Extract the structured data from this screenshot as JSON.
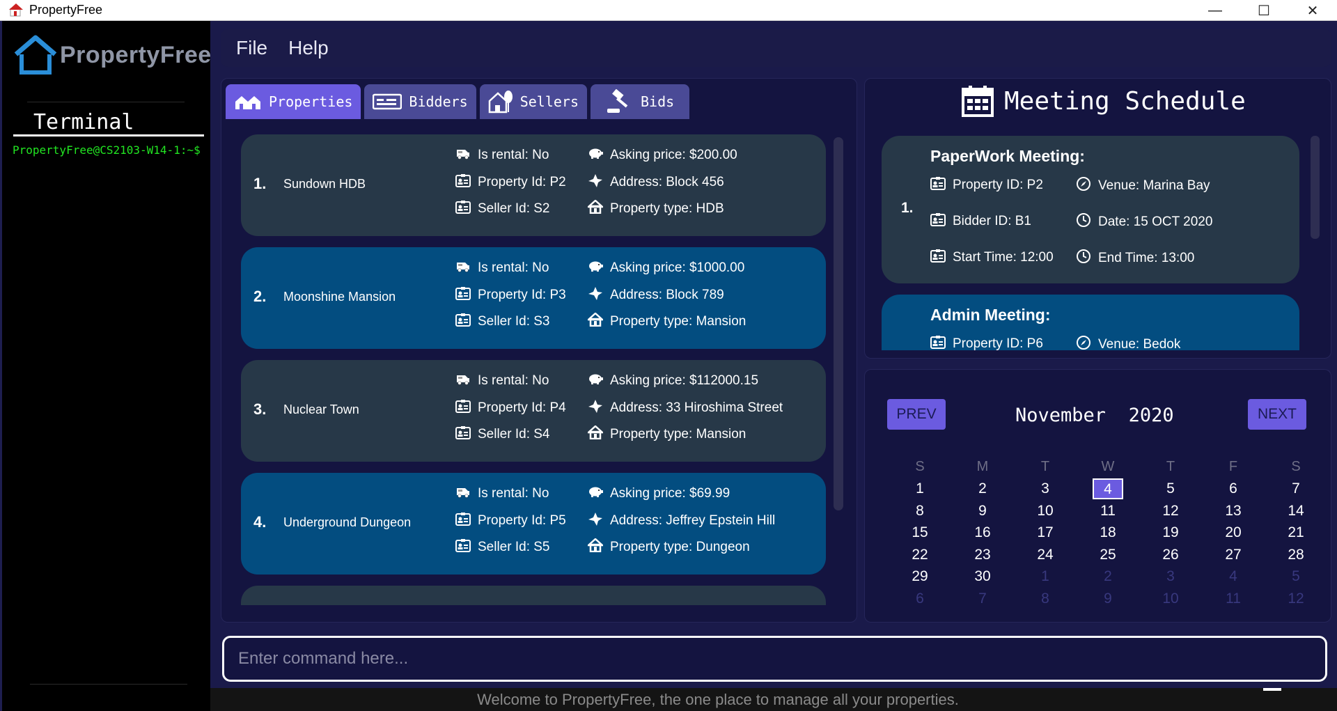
{
  "window": {
    "title": "PropertyFree",
    "controls": {
      "minimize": "—",
      "maximize": "☐",
      "close": "✕"
    }
  },
  "sidebar": {
    "logo_text": "PropertyFree",
    "terminal_title": "Terminal",
    "prompt": "PropertyFree@CS2103-W14-1:~$"
  },
  "menu": {
    "file": "File",
    "help": "Help"
  },
  "tabs": [
    {
      "label": "Properties",
      "icon": "houses-icon",
      "active": true
    },
    {
      "label": "Bidders",
      "icon": "id-card-icon",
      "active": false
    },
    {
      "label": "Sellers",
      "icon": "house-tree-icon",
      "active": false
    },
    {
      "label": "Bids",
      "icon": "gavel-icon",
      "active": false
    }
  ],
  "properties": [
    {
      "index": "1.",
      "name": "Sundown HDB",
      "rental": "Is rental: No",
      "property_id": "Property Id: P2",
      "seller_id": "Seller Id: S2",
      "price": "Asking price: $200.00",
      "address": "Address: Block 456",
      "type": "Property type: HDB"
    },
    {
      "index": "2.",
      "name": "Moonshine Mansion",
      "rental": "Is rental: No",
      "property_id": "Property Id: P3",
      "seller_id": "Seller Id: S3",
      "price": "Asking price: $1000.00",
      "address": "Address: Block 789",
      "type": "Property type: Mansion"
    },
    {
      "index": "3.",
      "name": "Nuclear Town",
      "rental": "Is rental: No",
      "property_id": "Property Id: P4",
      "seller_id": "Seller Id: S4",
      "price": "Asking price: $112000.15",
      "address": "Address: 33 Hiroshima Street",
      "type": "Property type: Mansion"
    },
    {
      "index": "4.",
      "name": "Underground Dungeon",
      "rental": "Is rental: No",
      "property_id": "Property Id: P5",
      "seller_id": "Seller Id: S5",
      "price": "Asking price: $69.99",
      "address": "Address: Jeffrey Epstein Hill",
      "type": "Property type: Dungeon"
    }
  ],
  "meeting_schedule": {
    "title": "Meeting Schedule",
    "meetings": [
      {
        "index": "1.",
        "name": "PaperWork Meeting:",
        "property_id": "Property ID: P2",
        "bidder_id": "Bidder ID: B1",
        "start": "Start Time: 12:00",
        "venue": "Venue: Marina Bay",
        "date": "Date: 15 OCT 2020",
        "end": "End Time: 13:00"
      },
      {
        "index": "",
        "name": "Admin Meeting:",
        "property_id": "Property ID: P6",
        "venue": "Venue: Bedok"
      }
    ]
  },
  "calendar": {
    "prev": "PREV",
    "next": "NEXT",
    "month": "November",
    "year": "2020",
    "weekdays": [
      "S",
      "M",
      "T",
      "W",
      "T",
      "F",
      "S"
    ],
    "selected_day": "4",
    "days": [
      [
        "1",
        "2",
        "3",
        "4",
        "5",
        "6",
        "7"
      ],
      [
        "8",
        "9",
        "10",
        "11",
        "12",
        "13",
        "14"
      ],
      [
        "15",
        "16",
        "17",
        "18",
        "19",
        "20",
        "21"
      ],
      [
        "22",
        "23",
        "24",
        "25",
        "26",
        "27",
        "28"
      ],
      [
        "29",
        "30",
        "1",
        "2",
        "3",
        "4",
        "5"
      ],
      [
        "6",
        "7",
        "8",
        "9",
        "10",
        "11",
        "12"
      ]
    ]
  },
  "command": {
    "placeholder": "Enter command here..."
  },
  "status": {
    "message": "Welcome to PropertyFree, the one place to manage all your properties."
  },
  "colors": {
    "background": "#1a1a4a",
    "panel": "#141440",
    "tab_active": "#6b5be0",
    "tab_inactive": "#4a4a96",
    "card_dark": "#273848",
    "card_blue": "#034d80",
    "terminal_green": "#22e622"
  }
}
